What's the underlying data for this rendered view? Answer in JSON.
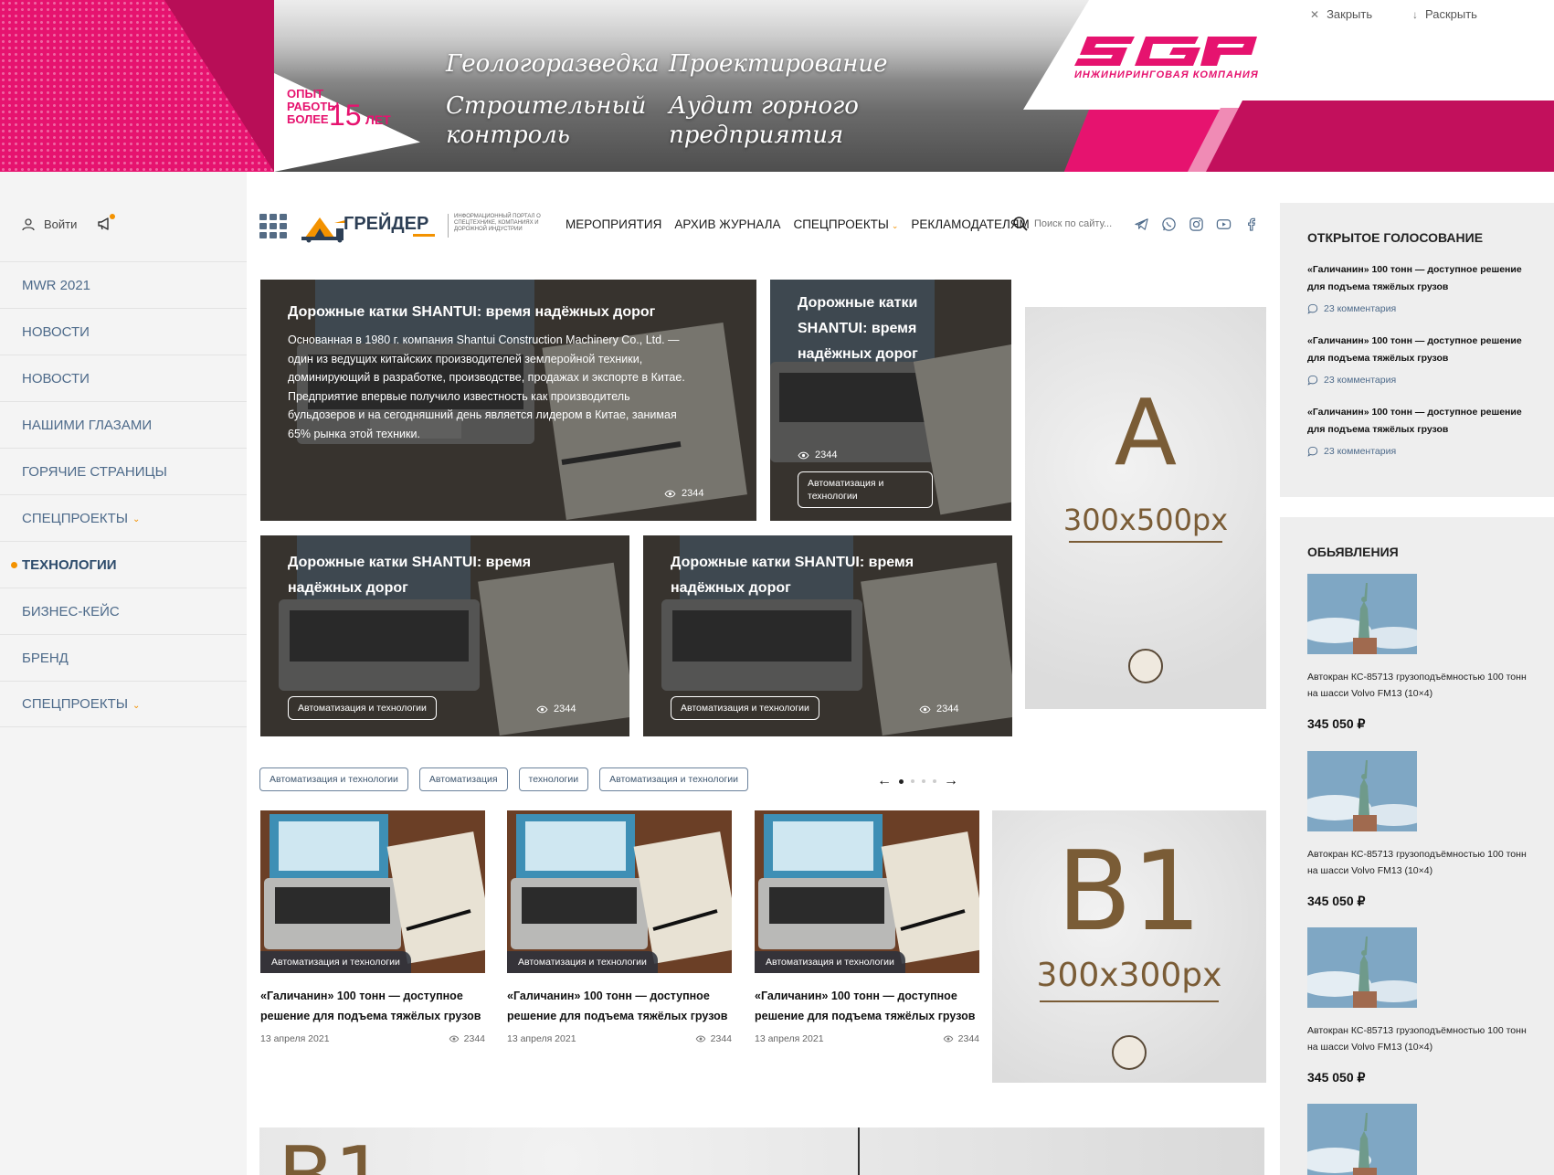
{
  "banner": {
    "experience_prefix": "ОПЫТ РАБОТЫ БОЛЕЕ",
    "experience_years": "15",
    "experience_suffix": "ЛЕТ",
    "services": [
      "Геологоразведка",
      "Строительный контроль",
      "Проектирование",
      "Аудит горного предприятия"
    ],
    "brand_logo": "SGP",
    "brand_subtitle": "ИНЖИНИРИНГОВАЯ КОМПАНИЯ",
    "close_label": "Закрыть",
    "expand_label": "Раскрыть"
  },
  "sidebar": {
    "login_label": "Войти",
    "items": [
      {
        "label": "MWR 2021"
      },
      {
        "label": "НОВОСТИ"
      },
      {
        "label": "НОВОСТИ"
      },
      {
        "label": "НАШИМИ ГЛАЗАМИ"
      },
      {
        "label": "ГОРЯЧИЕ СТРАНИЦЫ"
      },
      {
        "label": "СПЕЦПРОЕКТЫ",
        "has_dropdown": true
      },
      {
        "label": "ТЕХНОЛОГИИ",
        "active": true
      },
      {
        "label": "БИЗНЕС-КЕЙС"
      },
      {
        "label": "БРЕНД"
      },
      {
        "label": "СПЕЦПРОЕКТЫ",
        "has_dropdown": true
      }
    ]
  },
  "header": {
    "logo_text": "ГРЕЙДЕР",
    "logo_desc": "ИНФОРМАЦИОННЫЙ ПОРТАЛ О СПЕЦТЕХНИКЕ, КОМПАНИЯХ И ДОРОЖНОЙ ИНДУСТРИИ",
    "nav": [
      "МЕРОПРИЯТИЯ",
      "АРХИВ ЖУРНАЛА",
      "СПЕЦПРОЕКТЫ",
      "РЕКЛАМОДАТЕЛЯМ"
    ],
    "search_placeholder": "Поиск по сайту...",
    "socials": [
      "telegram-icon",
      "whatsapp-icon",
      "instagram-icon",
      "youtube-icon",
      "facebook-icon"
    ]
  },
  "featured": {
    "main": {
      "title": "Дорожные катки SHANTUI: время надёжных дорог",
      "text": "Основанная в 1980 г. компания Shantui Construction Machinery Co., Ltd. — один из ведущих китайских производителей землеройной техники, доминирующий в разработке, производстве, продажах и экспорте в Китае. Предприятие впервые получило известность как производитель бульдозеров и на сегодняшний день является лидером в Китае, занимая 65% рынка этой техники.",
      "views": "2344"
    },
    "side": {
      "title": "Дорожные катки SHANTUI: время надёжных дорог",
      "views": "2344",
      "tag": "Автоматизация и технологии"
    },
    "row": [
      {
        "title": "Дорожные катки SHANTUI: время надёжных дорог",
        "tag": "Автоматизация и технологии",
        "views": "2344"
      },
      {
        "title": "Дорожные катки SHANTUI: время надёжных дорог",
        "tag": "Автоматизация и технологии",
        "views": "2344"
      }
    ]
  },
  "ads": {
    "a": {
      "letter": "A",
      "size": "300x500px"
    },
    "b1": {
      "letter": "B1",
      "size": "300x300px"
    },
    "bottom": {
      "letter": "B1"
    }
  },
  "tags": [
    "Автоматизация и технологии",
    "Автоматизация",
    "технологии",
    "Автоматизация и технологии"
  ],
  "articles": [
    {
      "label": "Автоматизация и технологии",
      "title": "«Галичанин» 100 тонн — доступное решение для подъема тяжёлых грузов",
      "date": "13 апреля 2021",
      "views": "2344"
    },
    {
      "label": "Автоматизация и технологии",
      "title": "«Галичанин» 100 тонн — доступное решение для подъема тяжёлых грузов",
      "date": "13 апреля 2021",
      "views": "2344"
    },
    {
      "label": "Автоматизация и технологии",
      "title": "«Галичанин» 100 тонн — доступное решение для подъема тяжёлых грузов",
      "date": "13 апреля 2021",
      "views": "2344"
    }
  ],
  "voting": {
    "heading": "ОТКРЫТОЕ ГОЛОСОВАНИЕ",
    "items": [
      {
        "question": "«Галичанин» 100 тонн — доступное решение для подъема тяжёлых грузов",
        "comments": "23 комментария"
      },
      {
        "question": "«Галичанин» 100 тонн — доступное решение для подъема тяжёлых грузов",
        "comments": "23 комментария"
      },
      {
        "question": "«Галичанин» 100 тонн — доступное решение для подъема тяжёлых грузов",
        "comments": "23 комментария"
      }
    ]
  },
  "classifieds": {
    "heading": "ОБЬЯВЛЕНИЯ",
    "items": [
      {
        "desc": "Автокран КС-85713 грузоподъёмностью 100 тонн на шасси Volvo FM13 (10×4)",
        "price": "345 050 ₽"
      },
      {
        "desc": "Автокран КС-85713 грузоподъёмностью 100 тонн на шасси Volvo FM13 (10×4)",
        "price": "345 050 ₽"
      },
      {
        "desc": "Автокран КС-85713 грузоподъёмностью 100 тонн на шасси Volvo FM13 (10×4)",
        "price": "345 050 ₽"
      }
    ]
  },
  "colors": {
    "brand_pink": "#e6136f",
    "accent_orange": "#f39200",
    "nav_blue": "#4d6a8a",
    "ad_brown": "#7a5c36"
  }
}
